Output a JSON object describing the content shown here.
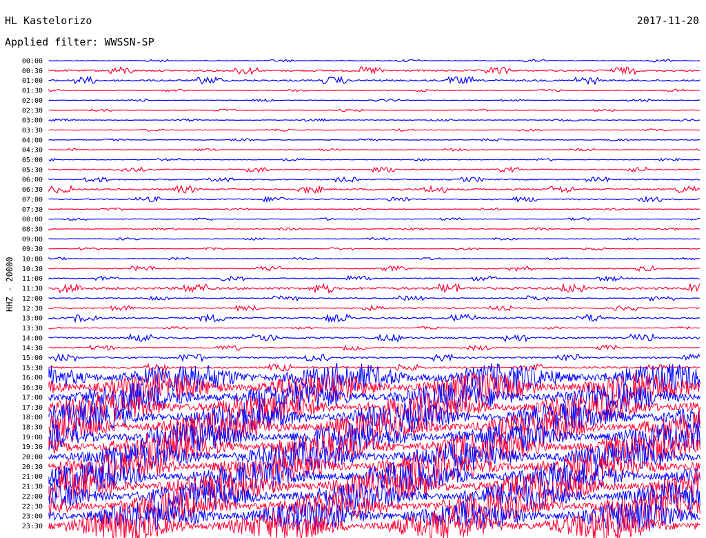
{
  "header": {
    "station": "HL Kastelorizo",
    "date": "2017-11-20",
    "filter_label": "Applied filter: WWSSN-SP"
  },
  "chart_data": {
    "type": "line",
    "ylabel": "HHZ - 20000",
    "row_labels": [
      "00:00",
      "00:30",
      "01:00",
      "01:30",
      "02:00",
      "02:30",
      "03:00",
      "03:30",
      "04:00",
      "04:30",
      "05:00",
      "05:30",
      "06:00",
      "06:30",
      "07:00",
      "07:30",
      "08:00",
      "08:30",
      "09:00",
      "09:30",
      "10:00",
      "10:30",
      "11:00",
      "11:30",
      "12:00",
      "12:30",
      "13:00",
      "13:30",
      "14:00",
      "14:30",
      "15:00",
      "15:30",
      "16:00",
      "16:30",
      "17:00",
      "17:30",
      "18:00",
      "18:30",
      "19:00",
      "19:30",
      "20:00",
      "20:30",
      "21:00",
      "21:30",
      "22:00",
      "22:30",
      "23:00",
      "23:30"
    ],
    "row_activity": [
      1,
      3,
      3,
      1,
      1,
      1,
      1,
      1,
      1,
      1,
      1,
      2,
      2,
      3,
      2,
      1,
      1,
      1,
      1,
      1,
      1,
      2,
      2,
      4,
      2,
      2,
      3,
      1,
      3,
      2,
      3,
      3,
      12,
      12,
      12,
      12,
      12,
      12,
      12,
      12,
      12,
      12,
      12,
      12,
      12,
      12,
      12,
      12
    ],
    "colors": {
      "even": "#0000ff",
      "odd": "#ff0033"
    }
  }
}
